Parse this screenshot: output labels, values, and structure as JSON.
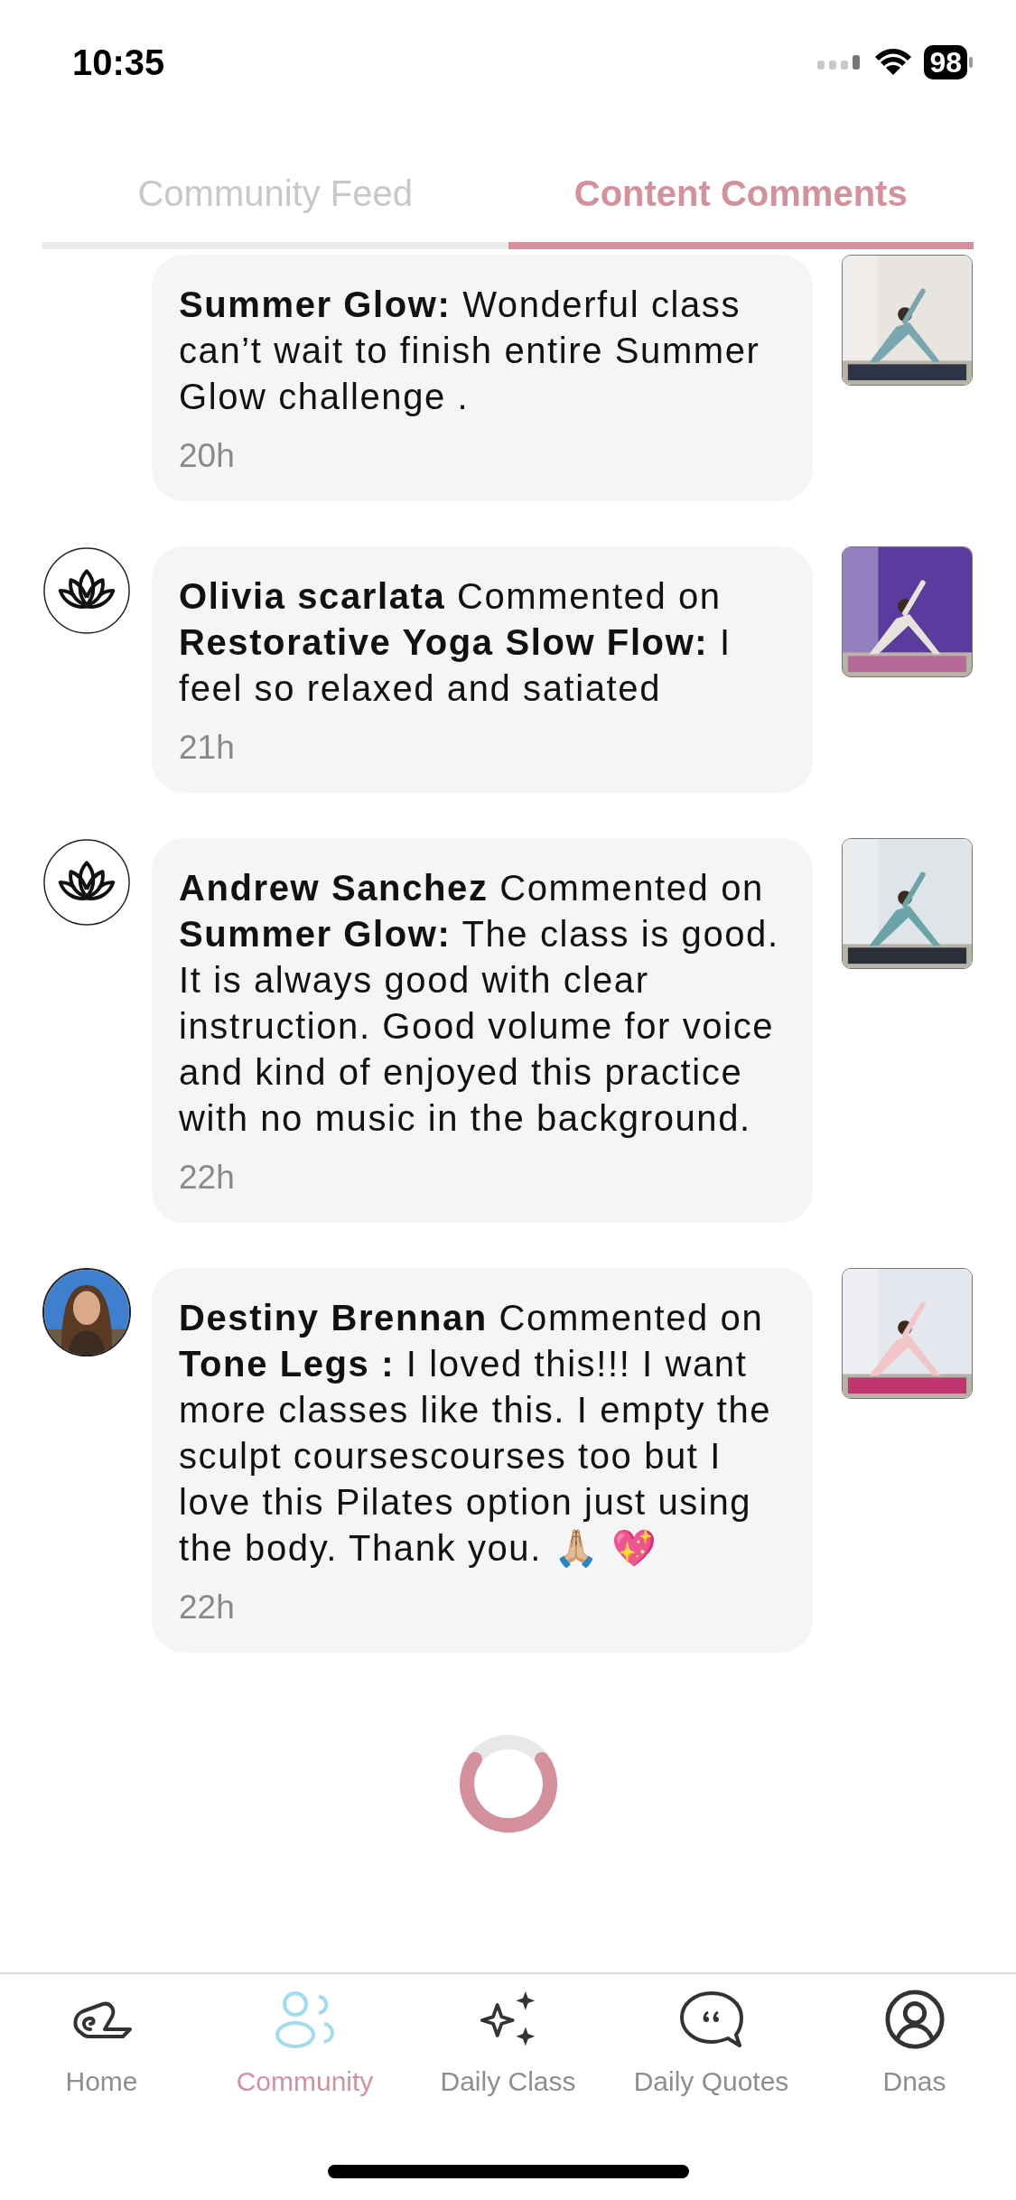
{
  "status_bar": {
    "time": "10:35",
    "battery": "98"
  },
  "tabs": [
    {
      "label": "Community Feed",
      "selected": false
    },
    {
      "label": "Content Comments",
      "selected": true
    }
  ],
  "comments": [
    {
      "text": "**Summer Glow:** Wonderful class can’t wait to finish entire Summer Glow challenge .",
      "time": "20h"
    },
    {
      "avatar": {
        "kind": "lotus"
      },
      "text": "**Olivia scarlata** Commented on **Restorative Yoga Slow Flow:** I feel so relaxed and satiated",
      "time": "21h"
    },
    {
      "avatar": {
        "kind": "lotus"
      },
      "text": "**Andrew Sanchez** Commented on **Summer Glow:** The class is good. It is always good with clear instruction. Good volume for voice and kind of enjoyed this practice with no music in the background.",
      "time": "22h"
    },
    {
      "text": "**Destiny Brennan** Commented on **Tone Legs :** I loved this!!! I want more classes like this. I empty the sculpt coursescourses too but I love this Pilates option just using the body. Thank you. 🙏🏼 💖",
      "time": "22h"
    }
  ],
  "nav": [
    {
      "label": "Home",
      "selected": false
    },
    {
      "label": "Community",
      "selected": true
    },
    {
      "label": "Daily Class",
      "selected": false
    },
    {
      "label": "Daily Quotes",
      "selected": false
    },
    {
      "label": "Dnas",
      "selected": false
    }
  ]
}
